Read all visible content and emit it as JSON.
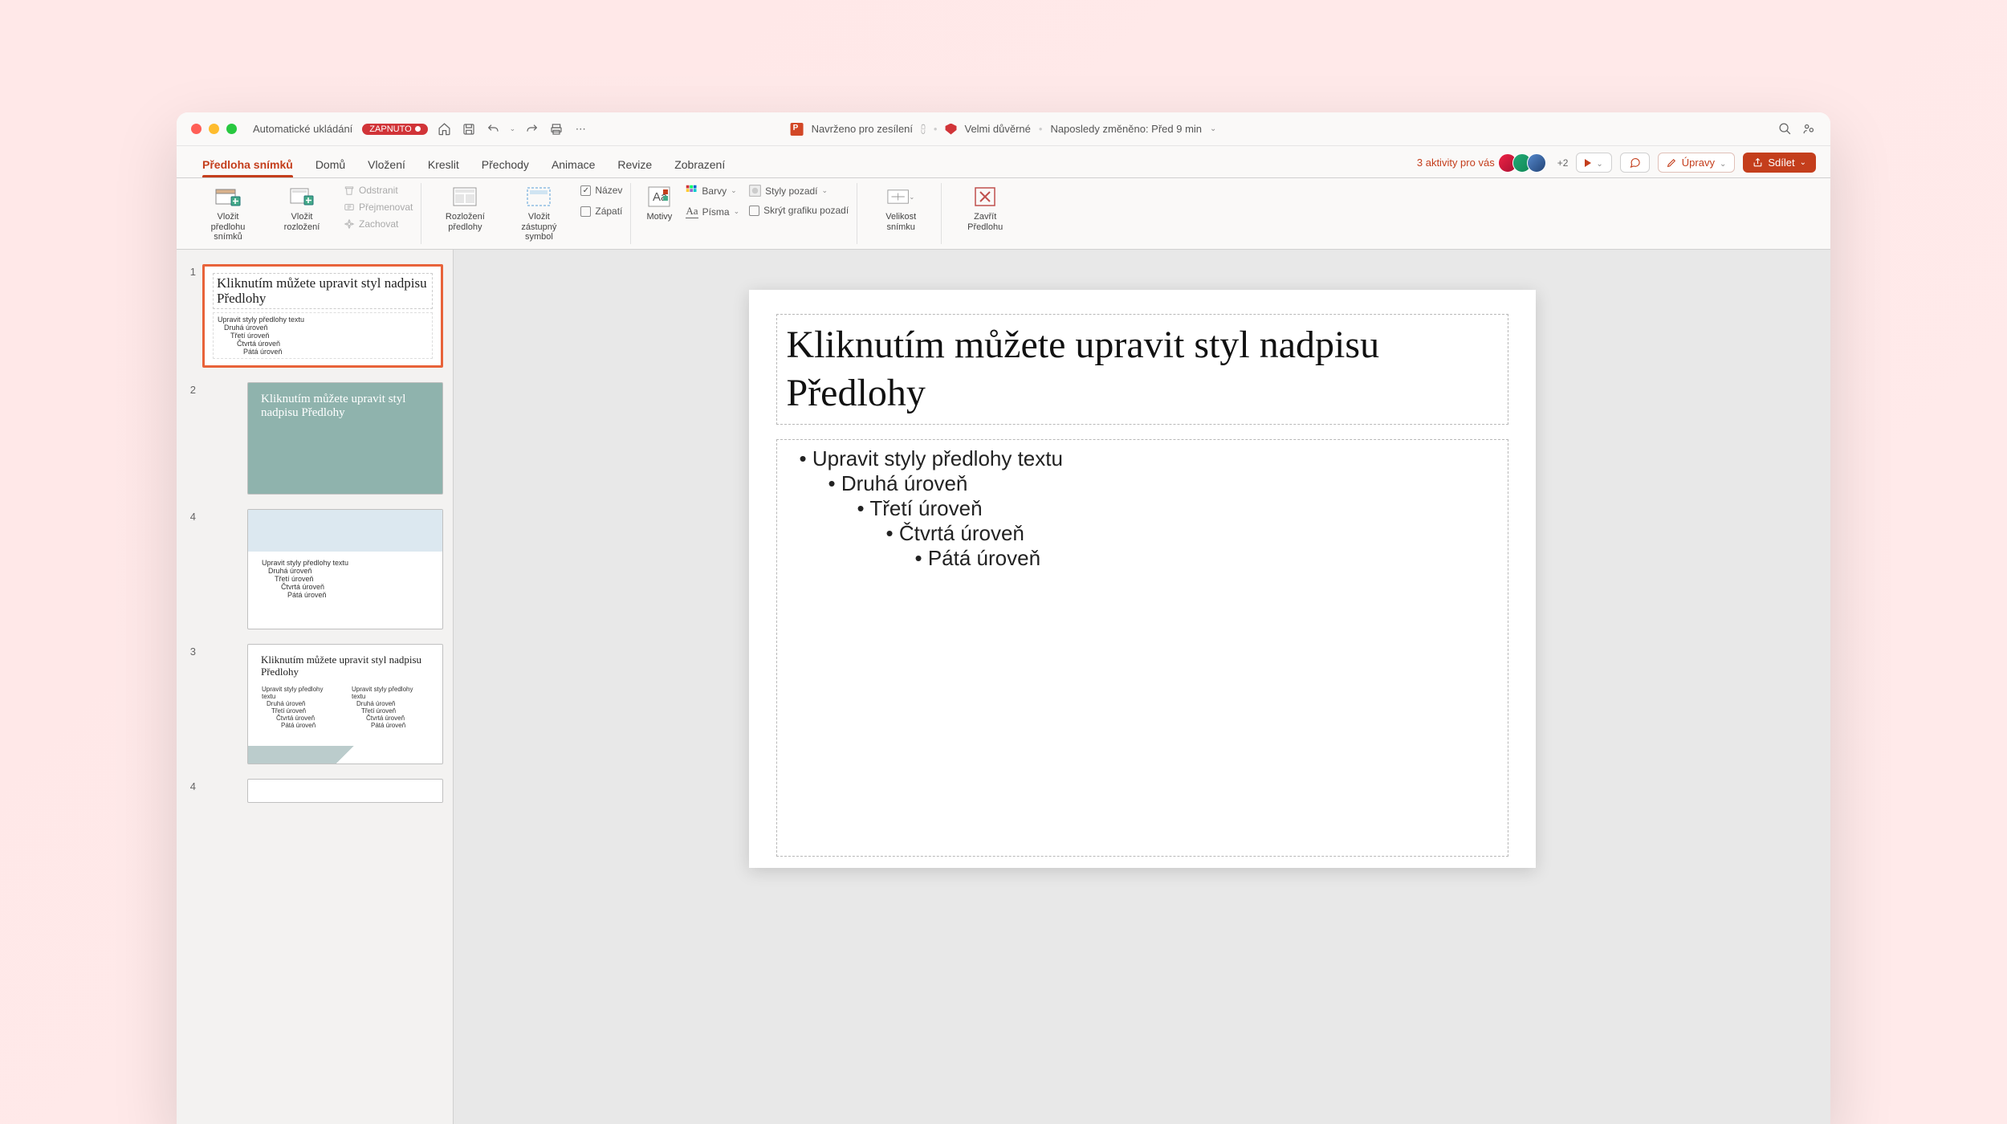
{
  "titlebar": {
    "autosave_label": "Automatické ukládání",
    "autosave_state": "ZAPNUTO",
    "center_designer": "Navrženo pro zesílení",
    "center_sensitivity": "Velmi důvěrné",
    "center_modified": "Naposledy změněno: Před 9 min"
  },
  "tabs": {
    "items": [
      "Předloha snímků",
      "Domů",
      "Vložení",
      "Kreslit",
      "Přechody",
      "Animace",
      "Revize",
      "Zobrazení"
    ],
    "active_index": 0,
    "activity_text": "3 aktivity pro vás",
    "plus_badge": "+2",
    "edit_label": "Úpravy",
    "share_label": "Sdílet"
  },
  "ribbon": {
    "insert_master": "Vložit předlohu snímků",
    "insert_layout": "Vložit rozložení",
    "delete": "Odstranit",
    "rename": "Přejmenovat",
    "preserve": "Zachovat",
    "master_layout": "Rozložení předlohy",
    "insert_placeholder": "Vložit zástupný symbol",
    "title_chk": "Název",
    "footer_chk": "Zápatí",
    "themes": "Motivy",
    "colors": "Barvy",
    "fonts": "Písma",
    "bg_styles": "Styly pozadí",
    "hide_bg": "Skrýt grafiku pozadí",
    "slide_size": "Velikost snímku",
    "close_master": "Zavřít Předlohu"
  },
  "slide": {
    "title": "Kliknutím můžete upravit styl nadpisu Předlohy",
    "levels": [
      "Upravit styly předlohy textu",
      "Druhá úroveň",
      "Třetí úroveň",
      "Čtvrtá úroveň",
      "Pátá úroveň"
    ]
  },
  "thumbs": {
    "t1_title": "Kliknutím můžete upravit styl nadpisu Předlohy",
    "t2_title": "Kliknutím můžete upravit styl nadpisu Předlohy",
    "levels_short": [
      "Upravit styly předlohy textu",
      "Druhá úroveň",
      "Třetí úroveň",
      "Čtvrtá úroveň",
      "Pátá úroveň"
    ]
  }
}
